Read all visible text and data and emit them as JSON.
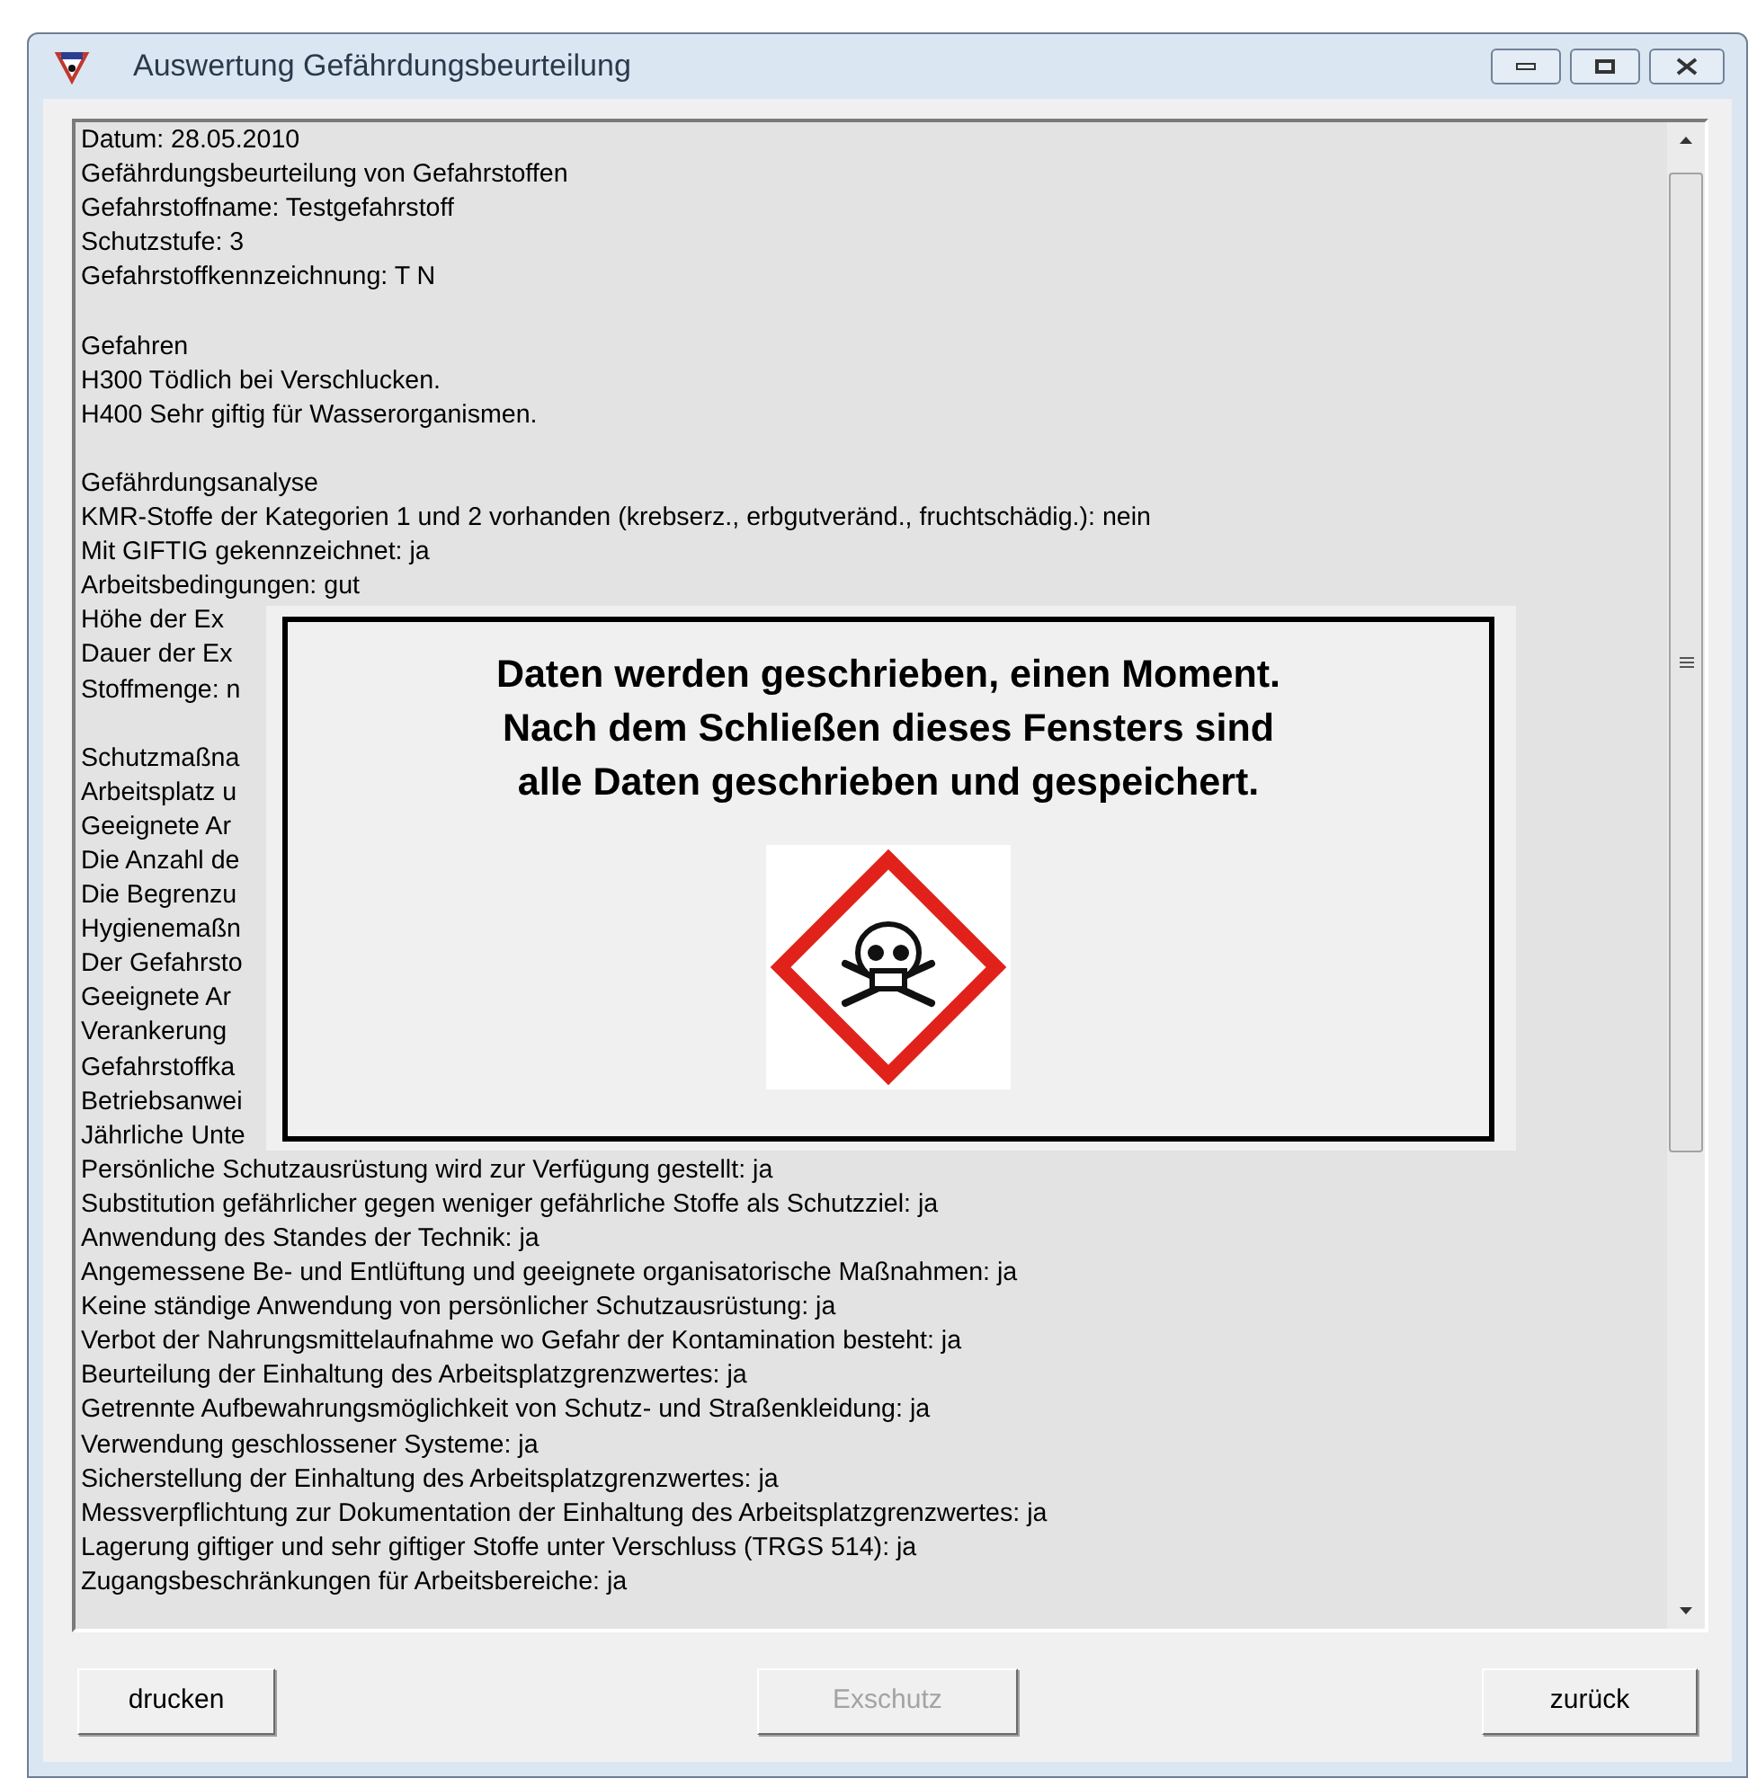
{
  "window": {
    "title": "Auswertung Gefährdungsbeurteilung"
  },
  "report": {
    "sections": [
      [
        "Datum: 28.05.2010",
        "Gefährdungsbeurteilung von Gefahrstoffen",
        "Gefahrstoffname: Testgefahrstoff",
        "Schutzstufe: 3",
        "Gefahrstoffkennzeichnung: T N"
      ],
      [
        "Gefahren",
        "H300 Tödlich bei Verschlucken.",
        "H400 Sehr giftig für Wasserorganismen."
      ],
      [
        "Gefährdungsanalyse",
        "KMR-Stoffe der Kategorien 1 und 2 vorhanden (krebserz., erbgutveränd., fruchtschädig.): nein",
        "Mit GIFTIG gekennzeichnet: ja",
        "Arbeitsbedingungen: gut",
        "Höhe der Ex",
        "Dauer der Ex",
        "Stoffmenge: n"
      ],
      [
        "Schutzmaßna",
        "Arbeitsplatz u",
        "Geeignete Ar",
        "Die Anzahl de",
        "Die Begrenzu",
        "Hygienemaßn",
        "Der Gefahrsto",
        "Geeignete Ar",
        "Verankerung",
        "Gefahrstoffka",
        "Betriebsanwei",
        "Jährliche Unte",
        "Persönliche Schutzausrüstung wird zur Verfügung gestellt: ja",
        "Substitution gefährlicher gegen weniger gefährliche Stoffe als Schutzziel: ja",
        "Anwendung des Standes der Technik: ja",
        "Angemessene Be- und Entlüftung und geeignete organisatorische Maßnahmen: ja",
        "Keine ständige Anwendung von persönlicher Schutzausrüstung: ja",
        "Verbot der Nahrungsmittelaufnahme wo Gefahr der Kontamination besteht: ja",
        "Beurteilung der Einhaltung des Arbeitsplatzgrenzwertes: ja",
        "Getrennte Aufbewahrungsmöglichkeit von Schutz- und Straßenkleidung: ja",
        "Verwendung geschlossener Systeme: ja",
        "Sicherstellung der Einhaltung des Arbeitsplatzgrenzwertes: ja",
        "Messverpflichtung zur Dokumentation der Einhaltung des Arbeitsplatzgrenzwertes: ja",
        "Lagerung giftiger und sehr giftiger Stoffe unter Verschluss (TRGS 514): ja",
        "Zugangsbeschränkungen für Arbeitsbereiche: ja"
      ]
    ]
  },
  "message": {
    "lines": [
      "Daten werden geschrieben, einen Moment.",
      "Nach dem Schließen dieses Fensters sind",
      "alle Daten geschrieben und gespeichert."
    ]
  },
  "buttons": [
    {
      "label": "drucken",
      "disabled": false
    },
    {
      "label": "Exschutz",
      "disabled": true
    },
    {
      "label": "zurück",
      "disabled": false
    }
  ]
}
